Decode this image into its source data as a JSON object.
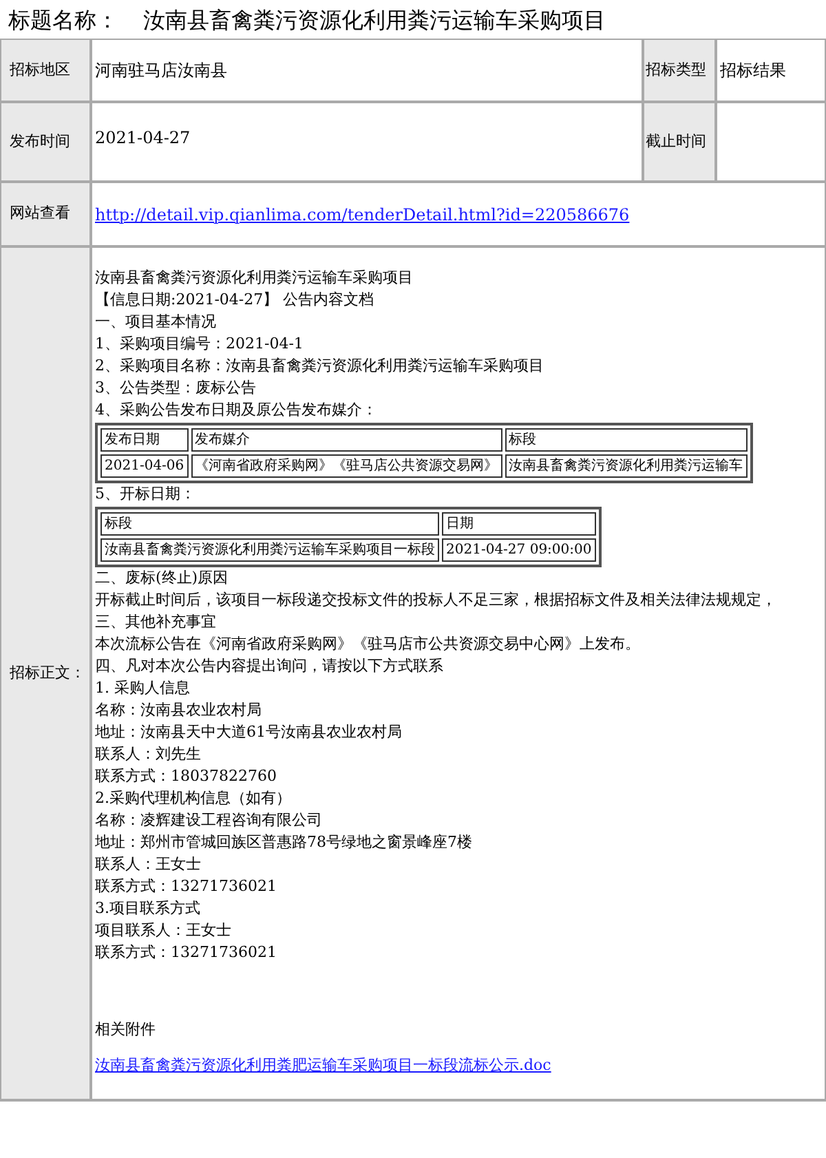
{
  "header": {
    "label": "标题名称：",
    "value": "汝南县畜禽粪污资源化利用粪污运输车采购项目"
  },
  "fields": [
    {
      "label": "招标地区",
      "value": "河南驻马店汝南县"
    },
    {
      "label": "招标类型",
      "value": "招标结果"
    },
    {
      "label": "发布时间",
      "value": "2021-04-27"
    },
    {
      "label": "截止时间"
    }
  ],
  "website": {
    "label": "网站查看",
    "url": "http://detail.vip.qianlima.com/tenderDetail.html?id=220586676"
  },
  "body": {
    "label": "招标正文：",
    "items": [
      {
        "kind": "line",
        "text": "汝南县畜禽粪污资源化利用粪污运输车采购项目"
      },
      {
        "kind": "line",
        "text": "【信息日期:2021-04-27】 公告内容文档"
      },
      {
        "kind": "line",
        "text": "一、项目基本情况"
      },
      {
        "kind": "line",
        "text": "1、采购项目编号：2021-04-1"
      },
      {
        "kind": "line",
        "text": "2、采购项目名称：汝南县畜禽粪污资源化利用粪污运输车采购项目"
      },
      {
        "kind": "line",
        "text": "3、公告类型：废标公告"
      },
      {
        "kind": "line",
        "text": "4、采购公告发布日期及原公告发布媒介："
      },
      {
        "kind": "table",
        "columns": [
          "发布日期",
          "发布媒介",
          "标段"
        ],
        "rows": [
          [
            "2021-04-06",
            "《河南省政府采购网》《驻马店公共资源交易网》",
            "汝南县畜禽粪污资源化利用粪污运输车"
          ]
        ]
      },
      {
        "kind": "line",
        "text": "5、开标日期："
      },
      {
        "kind": "table",
        "columns": [
          "标段",
          "日期"
        ],
        "rows": [
          [
            "汝南县畜禽粪污资源化利用粪污运输车采购项目一标段",
            "2021-04-27 09:00:00"
          ]
        ]
      },
      {
        "kind": "line",
        "text": "二、废标(终止)原因"
      },
      {
        "kind": "line",
        "text": "开标截止时间后，该项目一标段递交投标文件的投标人不足三家，根据招标文件及相关法律法规规定，"
      },
      {
        "kind": "line",
        "text": "三、其他补充事宜"
      },
      {
        "kind": "line",
        "text": "本次流标公告在《河南省政府采购网》《驻马店市公共资源交易中心网》上发布。"
      },
      {
        "kind": "line",
        "text": "四、凡对本次公告内容提出询问，请按以下方式联系"
      },
      {
        "kind": "line",
        "text": "1. 采购人信息"
      },
      {
        "kind": "line",
        "text": "名称：汝南县农业农村局"
      },
      {
        "kind": "line",
        "text": "地址：汝南县天中大道61号汝南县农业农村局"
      },
      {
        "kind": "line",
        "text": "联系人：刘先生"
      },
      {
        "kind": "line",
        "text": "联系方式：18037822760"
      },
      {
        "kind": "line",
        "text": "2.采购代理机构信息（如有）"
      },
      {
        "kind": "line",
        "text": "名称：凌辉建设工程咨询有限公司"
      },
      {
        "kind": "line",
        "text": "地址：郑州市管城回族区普惠路78号绿地之窗景峰座7楼"
      },
      {
        "kind": "line",
        "text": "联系人：王女士"
      },
      {
        "kind": "line",
        "text": "联系方式：13271736021"
      },
      {
        "kind": "line",
        "text": "3.项目联系方式"
      },
      {
        "kind": "line",
        "text": "项目联系人：王女士"
      },
      {
        "kind": "line",
        "text": "联系方式：13271736021"
      },
      {
        "kind": "attach_title",
        "text": "相关附件"
      },
      {
        "kind": "attach_link",
        "text": "汝南县畜禽粪污资源化利用粪肥运输车采购项目一标段流标公示.doc"
      }
    ]
  }
}
